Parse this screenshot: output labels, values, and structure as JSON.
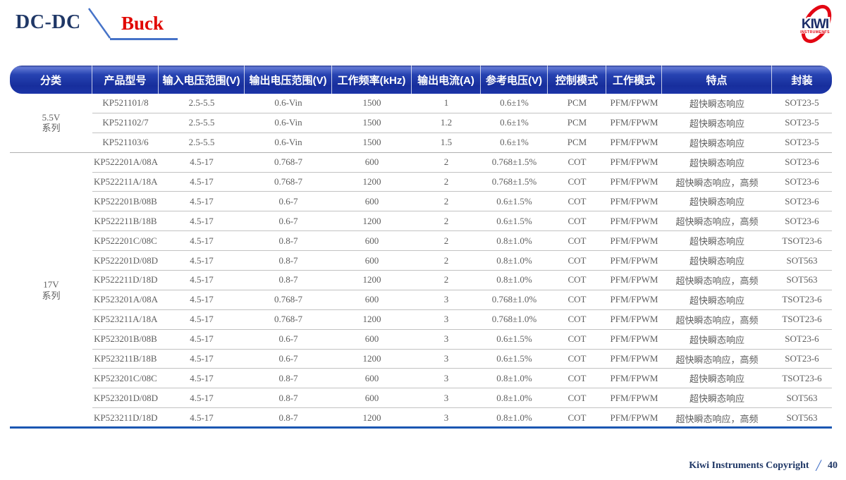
{
  "header": {
    "category": "DC-DC",
    "topic": "Buck"
  },
  "logo": {
    "name": "KIWI",
    "subtitle": "INSTRUMENTS"
  },
  "colors": {
    "navy": "#1f3766",
    "red": "#e10600",
    "logo_red": "#e30613",
    "deco_blue": "#4673c8",
    "header_blue": "#1c35a8",
    "body_text": "#5f5f5f",
    "bottom_rule_blue": "#1b57b2"
  },
  "table": {
    "headers": [
      "分类",
      "产品型号",
      "输入电压范围(V)",
      "输出电压范围(V)",
      "工作频率(kHz)",
      "输出电流(A)",
      "参考电压(V)",
      "控制模式",
      "工作模式",
      "特点",
      "封装"
    ],
    "groups": [
      {
        "label": [
          "5.5V",
          "系列"
        ],
        "rows": [
          [
            "KP521101/8",
            "2.5-5.5",
            "0.6-Vin",
            "1500",
            "1",
            "0.6±1%",
            "PCM",
            "PFM/FPWM",
            "超快瞬态响应",
            "SOT23-5"
          ],
          [
            "KP521102/7",
            "2.5-5.5",
            "0.6-Vin",
            "1500",
            "1.2",
            "0.6±1%",
            "PCM",
            "PFM/FPWM",
            "超快瞬态响应",
            "SOT23-5"
          ],
          [
            "KP521103/6",
            "2.5-5.5",
            "0.6-Vin",
            "1500",
            "1.5",
            "0.6±1%",
            "PCM",
            "PFM/FPWM",
            "超快瞬态响应",
            "SOT23-5"
          ]
        ]
      },
      {
        "label": [
          "17V",
          "系列"
        ],
        "rows": [
          [
            "KP522201A/08A",
            "4.5-17",
            "0.768-7",
            "600",
            "2",
            "0.768±1.5%",
            "COT",
            "PFM/FPWM",
            "超快瞬态响应",
            "SOT23-6"
          ],
          [
            "KP522211A/18A",
            "4.5-17",
            "0.768-7",
            "1200",
            "2",
            "0.768±1.5%",
            "COT",
            "PFM/FPWM",
            "超快瞬态响应，高频",
            "SOT23-6"
          ],
          [
            "KP522201B/08B",
            "4.5-17",
            "0.6-7",
            "600",
            "2",
            "0.6±1.5%",
            "COT",
            "PFM/FPWM",
            "超快瞬态响应",
            "SOT23-6"
          ],
          [
            "KP522211B/18B",
            "4.5-17",
            "0.6-7",
            "1200",
            "2",
            "0.6±1.5%",
            "COT",
            "PFM/FPWM",
            "超快瞬态响应，高频",
            "SOT23-6"
          ],
          [
            "KP522201C/08C",
            "4.5-17",
            "0.8-7",
            "600",
            "2",
            "0.8±1.0%",
            "COT",
            "PFM/FPWM",
            "超快瞬态响应",
            "TSOT23-6"
          ],
          [
            "KP522201D/08D",
            "4.5-17",
            "0.8-7",
            "600",
            "2",
            "0.8±1.0%",
            "COT",
            "PFM/FPWM",
            "超快瞬态响应",
            "SOT563"
          ],
          [
            "KP522211D/18D",
            "4.5-17",
            "0.8-7",
            "1200",
            "2",
            "0.8±1.0%",
            "COT",
            "PFM/FPWM",
            "超快瞬态响应，高频",
            "SOT563"
          ],
          [
            "KP523201A/08A",
            "4.5-17",
            "0.768-7",
            "600",
            "3",
            "0.768±1.0%",
            "COT",
            "PFM/FPWM",
            "超快瞬态响应",
            "TSOT23-6"
          ],
          [
            "KP523211A/18A",
            "4.5-17",
            "0.768-7",
            "1200",
            "3",
            "0.768±1.0%",
            "COT",
            "PFM/FPWM",
            "超快瞬态响应，高频",
            "TSOT23-6"
          ],
          [
            "KP523201B/08B",
            "4.5-17",
            "0.6-7",
            "600",
            "3",
            "0.6±1.5%",
            "COT",
            "PFM/FPWM",
            "超快瞬态响应",
            "SOT23-6"
          ],
          [
            "KP523211B/18B",
            "4.5-17",
            "0.6-7",
            "1200",
            "3",
            "0.6±1.5%",
            "COT",
            "PFM/FPWM",
            "超快瞬态响应，高频",
            "SOT23-6"
          ],
          [
            "KP523201C/08C",
            "4.5-17",
            "0.8-7",
            "600",
            "3",
            "0.8±1.0%",
            "COT",
            "PFM/FPWM",
            "超快瞬态响应",
            "TSOT23-6"
          ],
          [
            "KP523201D/08D",
            "4.5-17",
            "0.8-7",
            "600",
            "3",
            "0.8±1.0%",
            "COT",
            "PFM/FPWM",
            "超快瞬态响应",
            "SOT563"
          ],
          [
            "KP523211D/18D",
            "4.5-17",
            "0.8-7",
            "1200",
            "3",
            "0.8±1.0%",
            "COT",
            "PFM/FPWM",
            "超快瞬态响应，高频",
            "SOT563"
          ]
        ]
      }
    ]
  },
  "footer": {
    "copyright": "Kiwi Instruments Copyright",
    "separator": "/",
    "page_number": "40"
  }
}
